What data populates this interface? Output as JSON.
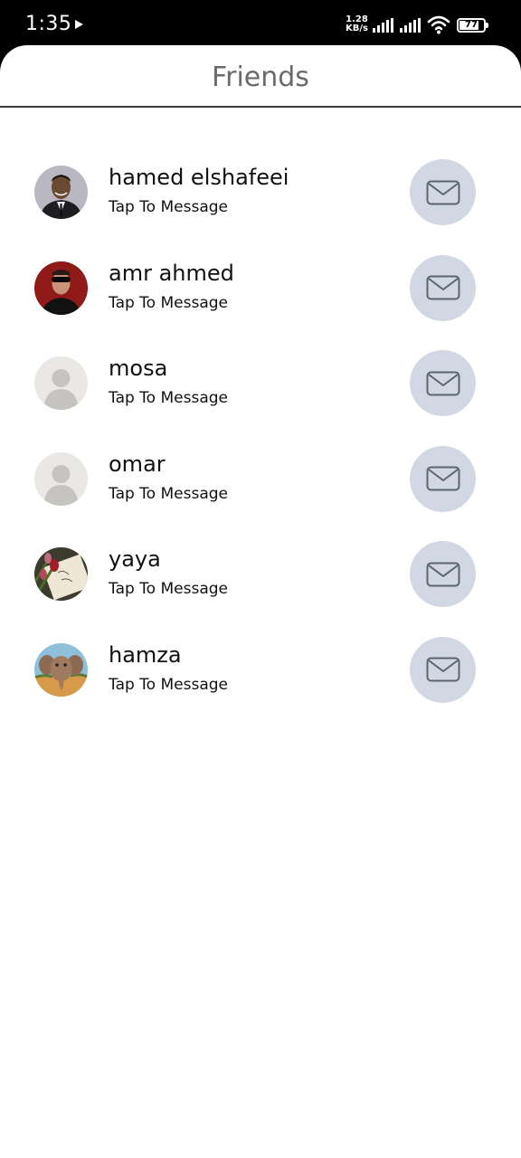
{
  "status_bar": {
    "time": "1:35",
    "speed_value": "1.28",
    "speed_unit": "KB/s",
    "battery": "77"
  },
  "header": {
    "title": "Friends"
  },
  "friends": [
    {
      "name": "hamed elshafeei",
      "subtitle": "Tap To Message",
      "avatar": "photo-man-suit"
    },
    {
      "name": "amr ahmed",
      "subtitle": "Tap To Message",
      "avatar": "photo-man-sunglasses"
    },
    {
      "name": "mosa",
      "subtitle": "Tap To Message",
      "avatar": "default-person"
    },
    {
      "name": "omar",
      "subtitle": "Tap To Message",
      "avatar": "default-person"
    },
    {
      "name": "yaya",
      "subtitle": "Tap To Message",
      "avatar": "photo-flowers-note"
    },
    {
      "name": "hamza",
      "subtitle": "Tap To Message",
      "avatar": "photo-elephant"
    }
  ],
  "icons": {
    "message": "envelope-icon"
  },
  "colors": {
    "message_button_bg": "#d2d8e3",
    "title": "#6b6b6b"
  }
}
